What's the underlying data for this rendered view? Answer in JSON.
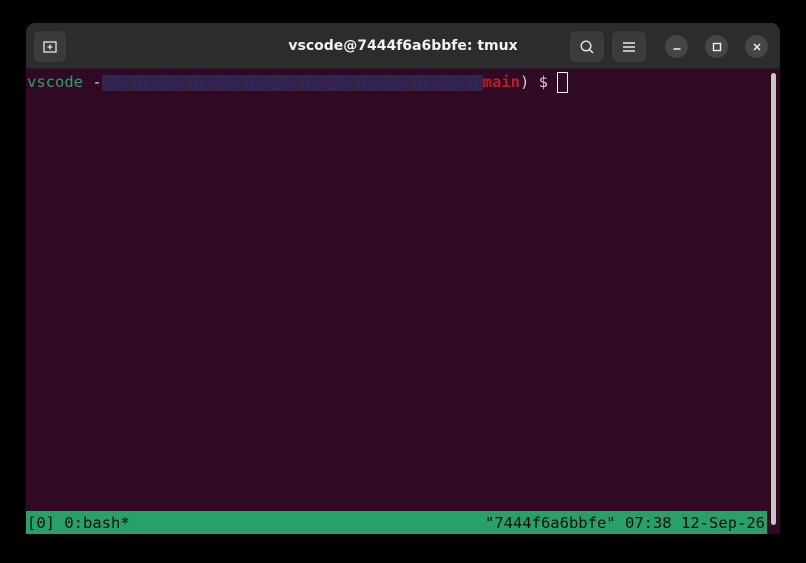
{
  "window": {
    "title": "vscode@7444f6a6bbfe: tmux"
  },
  "titlebar": {
    "icons": [
      "new-tab-icon",
      "search-icon",
      "menu-icon",
      "minimize-icon",
      "maximize-icon",
      "close-icon"
    ]
  },
  "terminal": {
    "prompt_user": "vscode",
    "prompt_sep": " -",
    "prompt_branch": "main",
    "prompt_close": ") $ "
  },
  "tmux_status": {
    "left": "[0] 0:bash*",
    "host": "\"7444f6a6bbfe\"",
    "time": "07:38",
    "date": "12-Sep-26"
  },
  "colors": {
    "terminal_bg": "#300a24",
    "status_bg": "#26a269",
    "prompt_user": "#26a269",
    "branch": "#c01c28"
  }
}
